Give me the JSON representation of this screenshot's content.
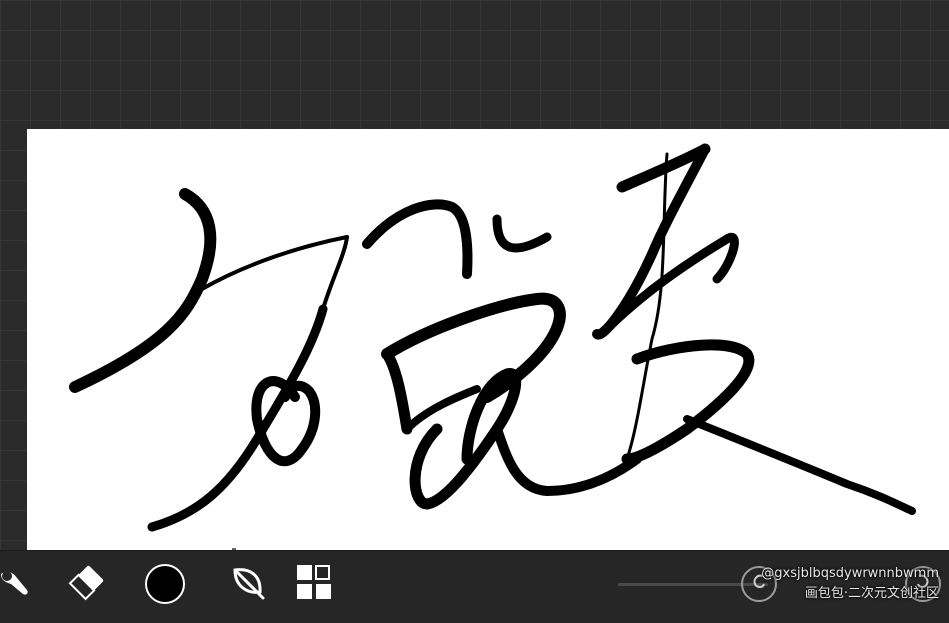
{
  "toolbar": {
    "tools": [
      {
        "name": "smudge-icon"
      },
      {
        "name": "eraser-icon"
      },
      {
        "name": "color-swatch"
      },
      {
        "name": "leaf-icon"
      },
      {
        "name": "layers-grid-icon"
      }
    ],
    "current_color": "#000000"
  },
  "watermark": {
    "username": "@gxsjblbqsdywrwnnbwmm",
    "community": "画包包·二次元文创社区"
  },
  "colors": {
    "workspace_bg": "#2b2b2b",
    "canvas_bg": "#ffffff",
    "ink": "#000000"
  }
}
